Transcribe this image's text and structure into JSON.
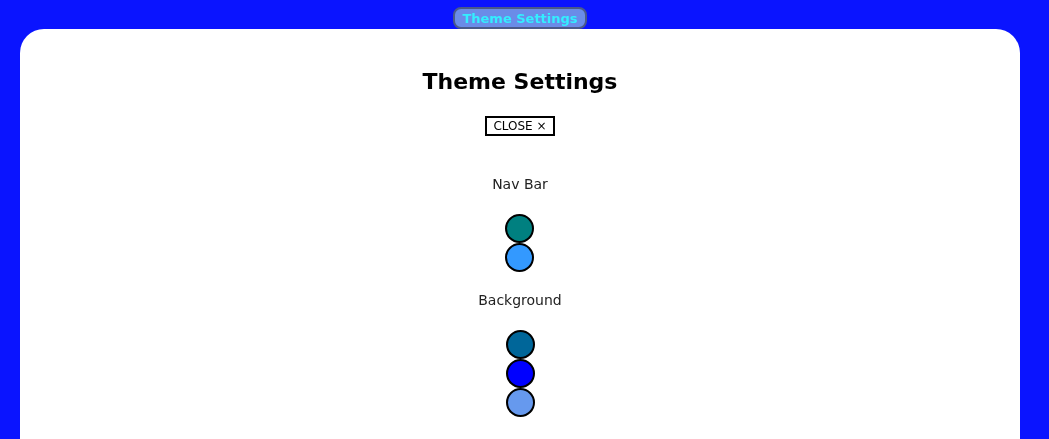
{
  "nav_button": {
    "label": "Theme Settings"
  },
  "panel": {
    "title": "Theme Settings",
    "close_button": "CLOSE ×",
    "sections": [
      {
        "label": "Nav Bar",
        "swatches": [
          {
            "color": "#008080"
          },
          {
            "color": "#3399ff"
          }
        ]
      },
      {
        "label": "Background",
        "swatches": [
          {
            "color": "#006699"
          },
          {
            "color": "#0000ff"
          },
          {
            "color": "#6699ee"
          }
        ]
      }
    ]
  }
}
